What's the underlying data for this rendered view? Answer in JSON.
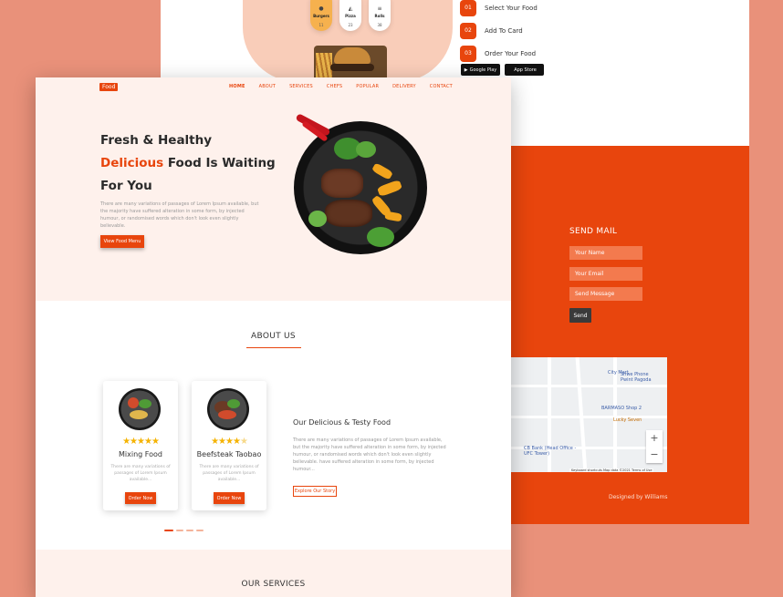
{
  "back_page": {
    "categories": [
      {
        "icon": "burger-icon",
        "name": "Burgers",
        "count": "11",
        "active": true
      },
      {
        "icon": "pizza-icon",
        "name": "Pizza",
        "count": "23",
        "active": false
      },
      {
        "icon": "rolls-icon",
        "name": "Rolls",
        "count": "38",
        "active": false
      }
    ],
    "steps": [
      {
        "num": "01",
        "text": "Select Your Food"
      },
      {
        "num": "02",
        "text": "Add To Card"
      },
      {
        "num": "03",
        "text": "Order Your Food"
      }
    ],
    "store_badges": [
      "Google Play",
      "App Store"
    ],
    "contact": {
      "title": "SEND MAIL",
      "name_placeholder": "Your Name",
      "email_placeholder": "Your Email",
      "message_placeholder": "Send Message",
      "send_label": "Send"
    },
    "map": {
      "labels": [
        "City Mart",
        "Shwe Phone Pwint Pagoda",
        "BARMASO Shop 2",
        "Lucky Seven",
        "CB Bank (Head Office - UFC Tower)"
      ],
      "attribution": "Keyboard shortcuts  Map data ©2021  Terms of Use"
    },
    "footer_text": "Designed by Williams"
  },
  "front_page": {
    "logo": "Food",
    "nav": [
      "HOME",
      "ABOUT",
      "SERVICES",
      "CHEFS",
      "POPULAR",
      "DELIVERY",
      "CONTACT"
    ],
    "hero": {
      "line1": "Fresh & Healthy",
      "line2_accent": "Delicious",
      "line2_rest": " Food Is Waiting",
      "line3": "For You",
      "description": "There are many variations of passages of Lorem Ipsum available, but the majority have suffered alteration in some form, by injected humour, or randomised words which don't look even slightly believable.",
      "cta": "View Food Menu"
    },
    "about": {
      "title": "ABOUT US",
      "cards": [
        {
          "name": "Mixing Food",
          "rating": 5,
          "description": "There are many variations of passages of Lorem Ipsum available...",
          "button": "Order Now"
        },
        {
          "name": "Beefsteak Taobao",
          "rating": 4,
          "description": "There are many variations of passages of Lorem Ipsum available...",
          "button": "Order Now"
        }
      ],
      "story_title": "Our Delicious & Testy Food",
      "story_description": "There are many variations of passages of Lorem Ipsum available, but the majority have suffered alteration in some form, by injected humour, or randomised words which don't look even slightly believable. have suffered alteration in some form, by injected humour...",
      "story_button": "Explore Our Story",
      "slider_active": 0,
      "slider_count": 4
    },
    "services_title": "OUR SERVICES"
  },
  "colors": {
    "accent": "#E8450D",
    "background": "#E9917A",
    "hero_bg": "#FEF1EC"
  }
}
